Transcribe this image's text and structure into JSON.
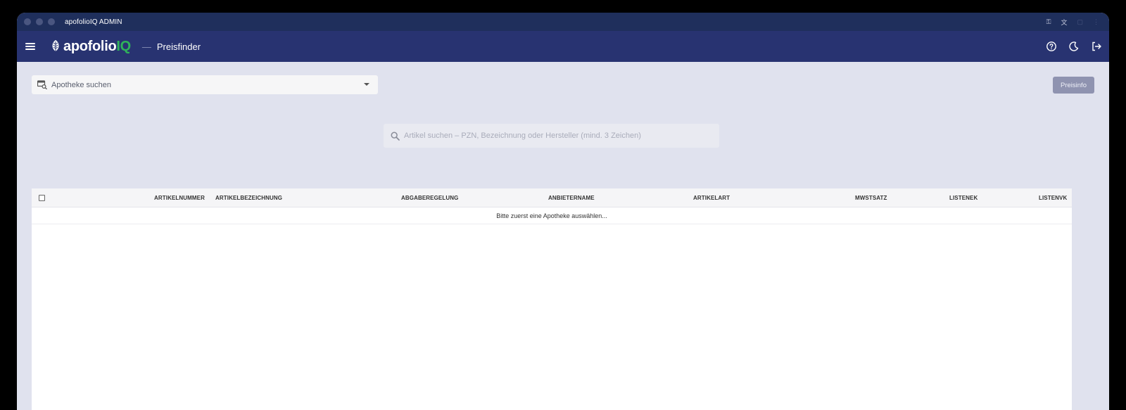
{
  "window": {
    "title": "apofolioIQ ADMIN"
  },
  "appbar": {
    "logo_main": "apofolio",
    "logo_accent": "IQ",
    "separator": "—",
    "page_title": "Preisfinder"
  },
  "pharmacy_select": {
    "placeholder": "Apotheke suchen"
  },
  "preisinfo_button": {
    "label": "Preisinfo"
  },
  "article_search": {
    "placeholder": "Artikel suchen – PZN, Bezeichnung oder Hersteller (mind. 3 Zeichen)",
    "value": ""
  },
  "table": {
    "columns": [
      "ARTIKELNUMMER",
      "ARTIKELBEZEICHNUNG",
      "ABGABEREGELUNG",
      "ANBIETERNAME",
      "ARTIKELART",
      "MWSTSATZ",
      "LISTENEK",
      "LISTENVK"
    ],
    "empty_message": "Bitte zuerst eine Apotheke auswählen..."
  },
  "colors": {
    "titlebar": "#1f2f5c",
    "appbar": "#283371",
    "accent_green": "#2fb35a",
    "background": "#e0e2ee",
    "button": "#8f93b0"
  },
  "icons": [
    "menu-icon",
    "leaf-logo-icon",
    "key-icon",
    "translate-icon",
    "extension-icon",
    "more-icon",
    "pharmacy-search-icon",
    "dropdown-caret-icon",
    "search-icon",
    "help-icon",
    "dark-mode-icon",
    "logout-icon",
    "checkbox-icon"
  ]
}
